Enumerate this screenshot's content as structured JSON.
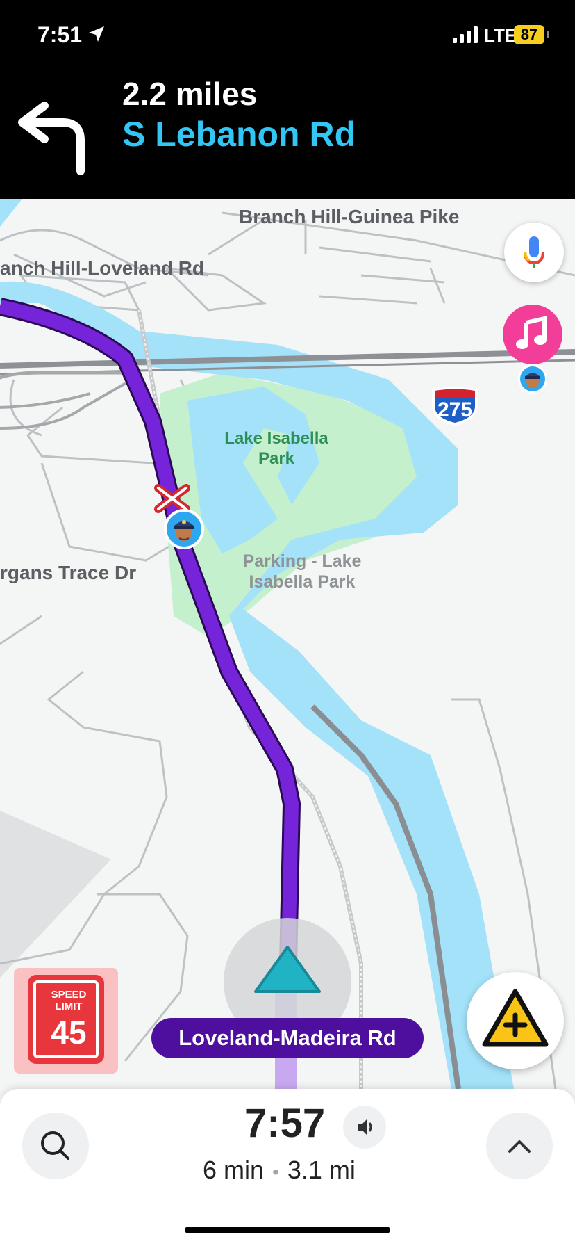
{
  "status_bar": {
    "time": "7:51",
    "network": "LTE",
    "battery": "87"
  },
  "nav": {
    "distance": "2.2 miles",
    "street": "S Lebanon Rd",
    "turn": "turn-left-icon"
  },
  "map_labels": {
    "road1": "Branch Hill-Guinea Pike",
    "road2": "anch Hill-Loveland Rd",
    "road3": "rgans Trace Dr",
    "park": "Lake Isabella Park",
    "parking": "Parking - Lake Isabella Park",
    "interstate": "275"
  },
  "speed_limit": {
    "title": "SPEED LIMIT",
    "value": "45"
  },
  "current_road": "Loveland-Madeira Rd",
  "trip": {
    "eta": "7:57",
    "duration": "6 min",
    "distance": "3.1 mi"
  },
  "colors": {
    "route": "#7524d9",
    "water": "#a4e2fa",
    "park": "#c4f0cd",
    "accent": "#33c5f3"
  }
}
